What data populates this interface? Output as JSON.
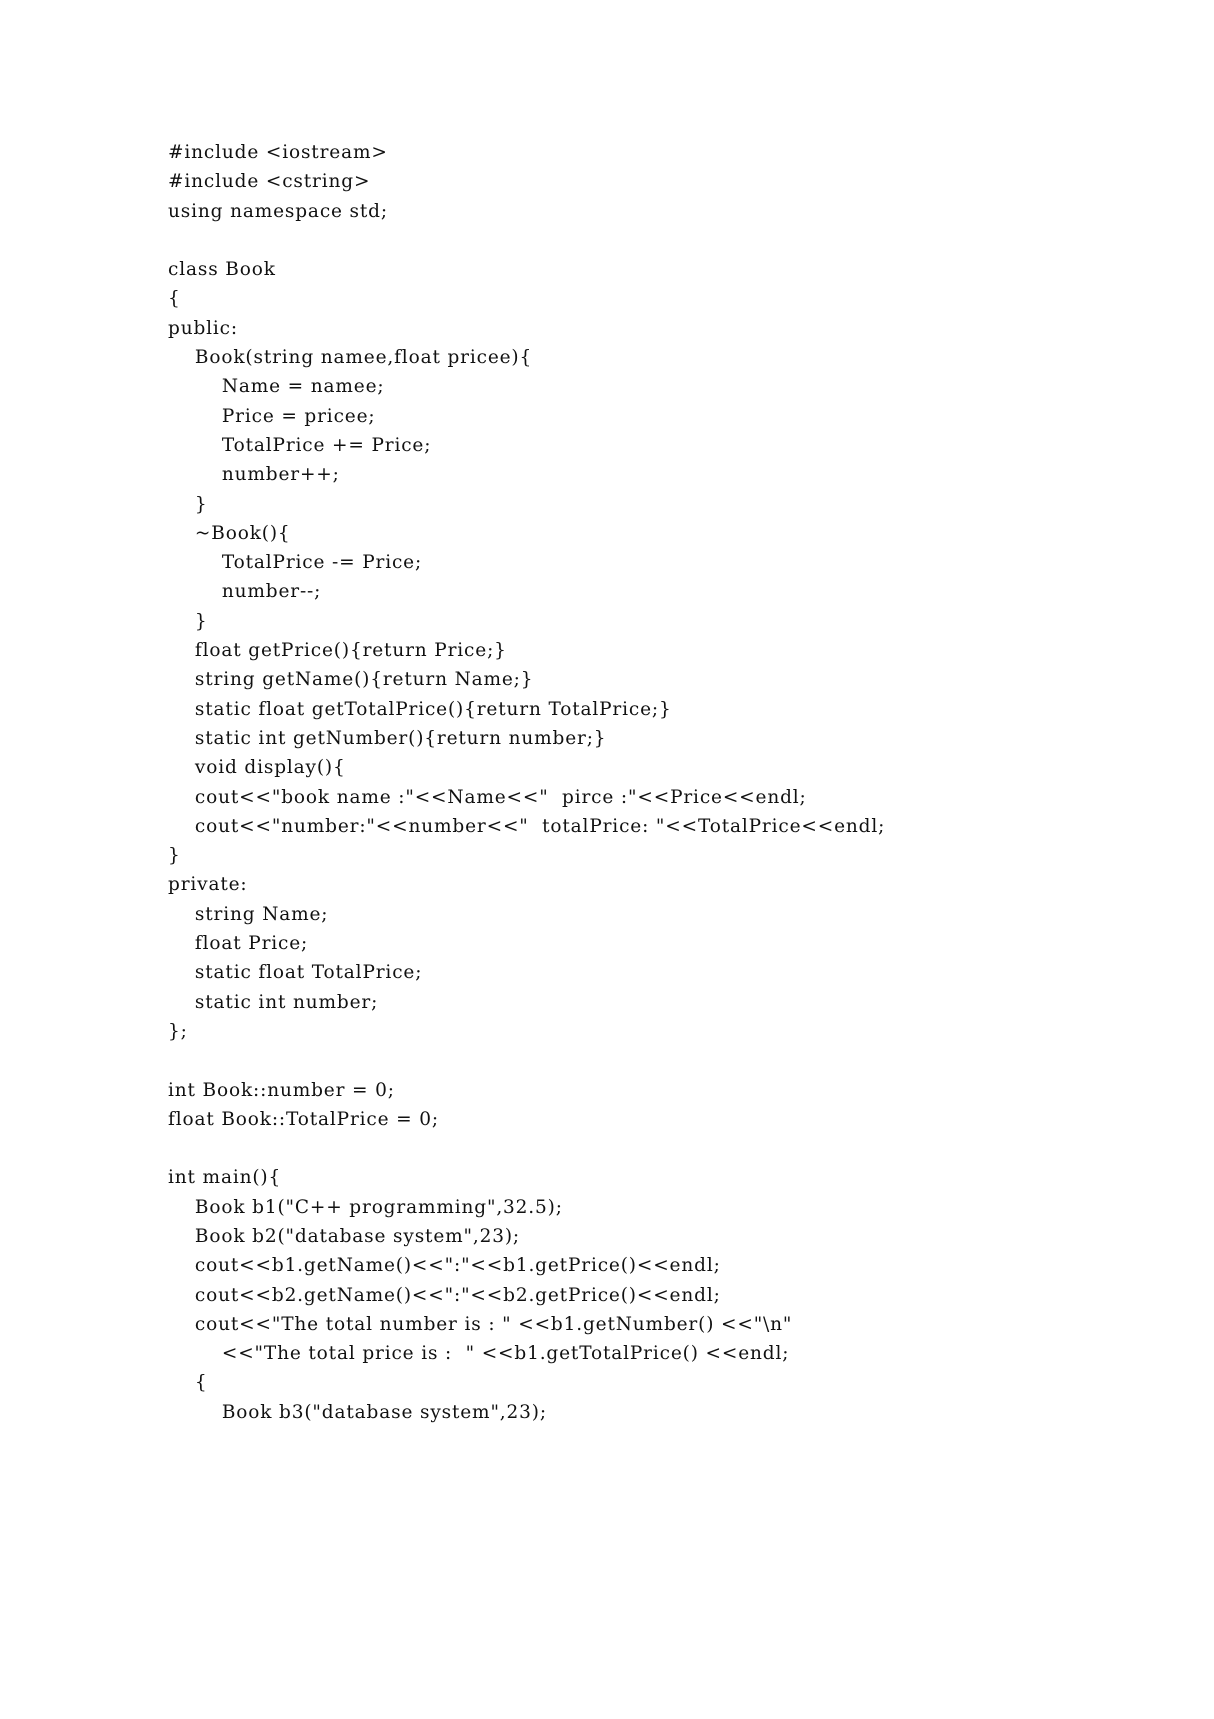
{
  "document": {
    "kind": "source-code-listing",
    "language": "C++",
    "background_color": "#ffffff",
    "text_color": "#111111",
    "lines": [
      "#include <iostream>",
      "#include <cstring>",
      "using namespace std;",
      "",
      "class Book",
      "{",
      "public:",
      "    Book(string namee,float pricee){",
      "        Name = namee;",
      "        Price = pricee;",
      "        TotalPrice += Price;",
      "        number++;",
      "    }",
      "    ~Book(){",
      "        TotalPrice -= Price;",
      "        number--;",
      "    }",
      "    float getPrice(){return Price;}",
      "    string getName(){return Name;}",
      "    static float getTotalPrice(){return TotalPrice;}",
      "    static int getNumber(){return number;}",
      "    void display(){",
      "    cout<<\"book name :\"<<Name<<\"  pirce :\"<<Price<<endl;",
      "    cout<<\"number:\"<<number<<\"  totalPrice: \"<<TotalPrice<<endl;",
      "}",
      "private:",
      "    string Name;",
      "    float Price;",
      "    static float TotalPrice;",
      "    static int number;",
      "};",
      "",
      "int Book::number = 0;",
      "float Book::TotalPrice = 0;",
      "",
      "int main(){",
      "    Book b1(\"C++ programming\",32.5);",
      "    Book b2(\"database system\",23);",
      "    cout<<b1.getName()<<\":\"<<b1.getPrice()<<endl;",
      "    cout<<b2.getName()<<\":\"<<b2.getPrice()<<endl;",
      "    cout<<\"The total number is : \" <<b1.getNumber() <<\"\\n\"",
      "        <<\"The total price is :  \" <<b1.getTotalPrice() <<endl;",
      "    {",
      "        Book b3(\"database system\",23);"
    ]
  }
}
